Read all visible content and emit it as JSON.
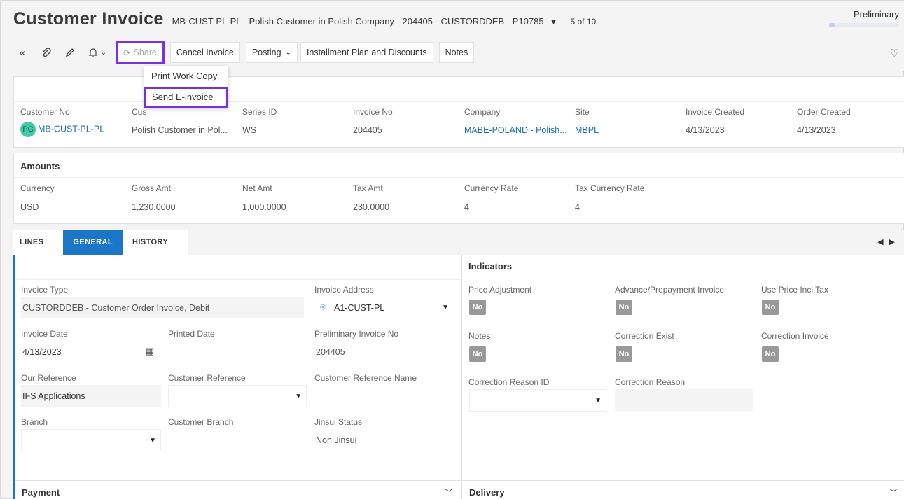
{
  "header": {
    "title": "Customer Invoice",
    "subtitle": "MB-CUST-PL-PL - Polish Customer in Polish Company - 204405 - CUSTORDDEB - P10785",
    "pager": "5 of 10",
    "status": "Preliminary"
  },
  "toolbar": {
    "share": "Share",
    "cancel_invoice": "Cancel Invoice",
    "posting": "Posting",
    "installment": "Installment Plan and Discounts",
    "notes": "Notes"
  },
  "share_menu": [
    "Print Work Copy",
    "Send E-invoice"
  ],
  "summary": {
    "labels": [
      "Customer No",
      "Cus",
      "Series ID",
      "Invoice No",
      "Company",
      "Site",
      "Invoice Created",
      "Order Created"
    ],
    "avatar": "PC",
    "customer_no": "MB-CUST-PL-PL",
    "customer_name": "Polish Customer in Pol...",
    "series_id": "WS",
    "invoice_no": "204405",
    "company": "MABE-POLAND - Polish...",
    "site": "MBPL",
    "invoice_created": "4/13/2023",
    "order_created": "4/13/2023"
  },
  "amounts": {
    "title": "Amounts",
    "labels": [
      "Currency",
      "Gross Amt",
      "Net Amt",
      "Tax Amt",
      "Currency Rate",
      "Tax Currency Rate"
    ],
    "values": [
      "USD",
      "1,230.0000",
      "1,000.0000",
      "230.0000",
      "4",
      "4"
    ]
  },
  "tabs": [
    "LINES",
    "GENERAL",
    "HISTORY"
  ],
  "general": {
    "invoice_type_label": "Invoice Type",
    "invoice_type": "CUSTORDDEB - Customer Order Invoice, Debit",
    "invoice_address_label": "Invoice Address",
    "invoice_address": "A1-CUST-PL",
    "invoice_date_label": "Invoice Date",
    "invoice_date": "4/13/2023",
    "printed_date_label": "Printed Date",
    "prelim_no_label": "Preliminary Invoice No",
    "prelim_no": "204405",
    "our_ref_label": "Our Reference",
    "our_ref": "IFS Applications",
    "cust_ref_label": "Customer Reference",
    "cust_ref_name_label": "Customer Reference Name",
    "branch_label": "Branch",
    "cust_branch_label": "Customer Branch",
    "jinsui_label": "Jinsui Status",
    "jinsui": "Non Jinsui",
    "payment": "Payment"
  },
  "indicators": {
    "title": "Indicators",
    "price_adj": "Price Adjustment",
    "advance": "Advance/Prepayment Invoice",
    "use_price": "Use Price Incl Tax",
    "notes": "Notes",
    "correction_exist": "Correction Exist",
    "correction_invoice": "Correction Invoice",
    "no": "No",
    "corr_reason_id": "Correction Reason ID",
    "corr_reason": "Correction Reason",
    "delivery": "Delivery"
  }
}
